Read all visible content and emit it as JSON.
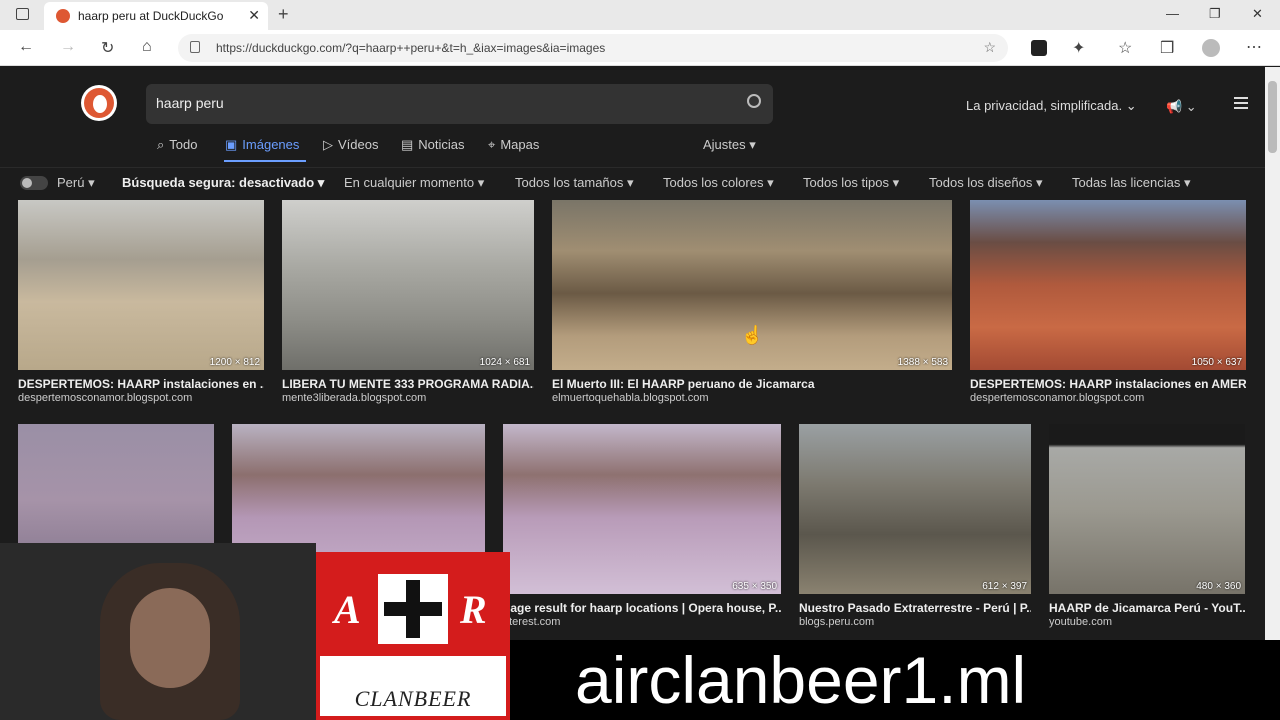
{
  "browser": {
    "tab_title": "haarp peru at DuckDuckGo",
    "url": "https://duckduckgo.com/?q=haarp++peru+&t=h_&iax=images&ia=images"
  },
  "ddg": {
    "search_query": "haarp peru",
    "privacy_text": "La privacidad, simplificada.",
    "tabs": [
      {
        "label": "Todo",
        "icon": "search-icon"
      },
      {
        "label": "Imágenes",
        "icon": "image-icon"
      },
      {
        "label": "Vídeos",
        "icon": "play-icon"
      },
      {
        "label": "Noticias",
        "icon": "news-icon"
      },
      {
        "label": "Mapas",
        "icon": "map-pin-icon"
      }
    ],
    "ajustes": "Ajustes",
    "filters": {
      "region": "Perú",
      "safe_search": "Búsqueda segura: desactivado",
      "time": "En cualquier momento",
      "size": "Todos los tamaños",
      "color": "Todos los colores",
      "type": "Todos los tipos",
      "layout": "Todos los diseños",
      "license": "Todas las licencias"
    }
  },
  "images_row1": [
    {
      "dims": "1200 × 812",
      "caption": "DESPERTEMOS: HAARP instalaciones en ...",
      "source": "despertemosconamor.blogspot.com"
    },
    {
      "dims": "1024 × 681",
      "caption": "LIBERA TU MENTE 333 PROGRAMA RADIA...",
      "source": "mente3liberada.blogspot.com"
    },
    {
      "dims": "1388 × 583",
      "caption": "El Muerto III: El HAARP peruano de Jicamarca",
      "source": "elmuertoquehabla.blogspot.com"
    },
    {
      "dims": "1050 × 637",
      "caption": "DESPERTEMOS: HAARP instalaciones en AMERI...",
      "source": "despertemosconamor.blogspot.com"
    }
  ],
  "images_row2": [
    {
      "dims": "",
      "caption": "",
      "source": ""
    },
    {
      "dims": "",
      "caption": "",
      "source": ""
    },
    {
      "dims": "635 × 350",
      "caption": "nage result for haarp locations | Opera house, P...",
      "source": "nterest.com"
    },
    {
      "dims": "612 × 397",
      "caption": "Nuestro Pasado Extraterrestre - Perú | P...",
      "source": "blogs.peru.com"
    },
    {
      "dims": "480 × 360",
      "caption": "HAARP de Jicamarca Perú - YouT...",
      "source": "youtube.com"
    }
  ],
  "overlay": {
    "banner_letters_left": "A",
    "banner_letters_right": "R",
    "banner_bottom": "CLANBEER",
    "promo_text": "airclanbeer1.ml"
  }
}
